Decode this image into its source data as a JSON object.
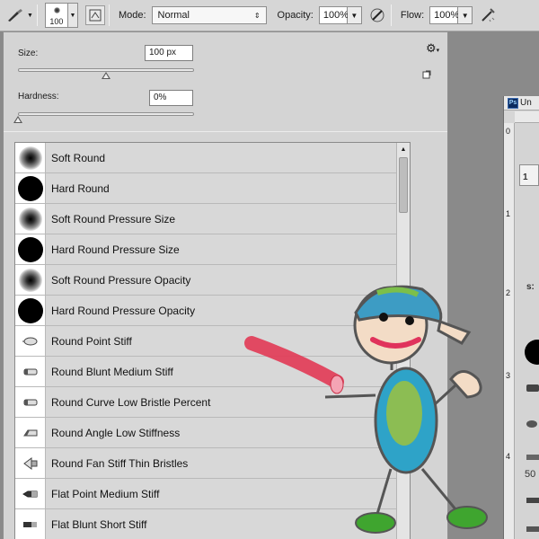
{
  "options_bar": {
    "brush_size": "100",
    "mode_label": "Mode:",
    "mode_value": "Normal",
    "opacity_label": "Opacity:",
    "opacity_value": "100%",
    "flow_label": "Flow:",
    "flow_value": "100%"
  },
  "brush_panel": {
    "size_label": "Size:",
    "size_value": "100 px",
    "size_slider_fraction": 0.5,
    "hardness_label": "Hardness:",
    "hardness_value": "0%",
    "hardness_slider_fraction": 0.0
  },
  "brushes": [
    {
      "name": "Soft Round",
      "tip": "soft"
    },
    {
      "name": "Hard Round",
      "tip": "hard"
    },
    {
      "name": "Soft Round Pressure Size",
      "tip": "soft"
    },
    {
      "name": "Hard Round Pressure Size",
      "tip": "hard"
    },
    {
      "name": "Soft Round Pressure Opacity",
      "tip": "soft"
    },
    {
      "name": "Hard Round Pressure Opacity",
      "tip": "hard"
    },
    {
      "name": "Round Point Stiff",
      "tip": "bristle-point"
    },
    {
      "name": "Round Blunt Medium Stiff",
      "tip": "bristle-blunt"
    },
    {
      "name": "Round Curve Low Bristle Percent",
      "tip": "bristle-blunt"
    },
    {
      "name": "Round Angle Low Stiffness",
      "tip": "bristle-angle"
    },
    {
      "name": "Round Fan Stiff Thin Bristles",
      "tip": "bristle-fan"
    },
    {
      "name": "Flat Point Medium Stiff",
      "tip": "bristle-flat-point"
    },
    {
      "name": "Flat Blunt Short Stiff",
      "tip": "bristle-flat-blunt"
    }
  ],
  "document": {
    "app_badge": "Ps",
    "title": "Un",
    "ruler_marks": [
      "0",
      "1",
      "2",
      "3",
      "4"
    ],
    "fragment_1": "1",
    "fragment_2": "s:",
    "fragment_3": "50"
  }
}
